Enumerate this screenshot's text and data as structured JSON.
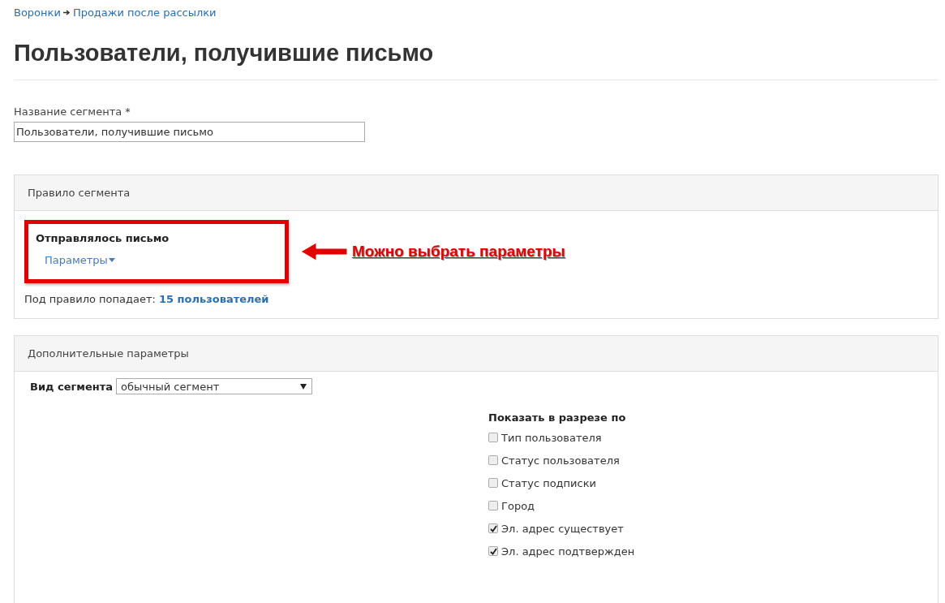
{
  "breadcrumb": [
    {
      "label": "Воронки"
    },
    {
      "label": "Продажи после рассылки"
    }
  ],
  "title": "Пользователи, получившие письмо",
  "segment_name": {
    "label": "Название сегмента",
    "required_mark": "*",
    "value": "Пользователи, получившие письмо"
  },
  "rule_panel": {
    "header": "Правило сегмента",
    "rule_title": "Отправлялось письмо",
    "params_link": "Параметры",
    "count_label": "Под правило попадает:",
    "count_link": "15 пользователей",
    "annotation": "Можно выбрать параметры"
  },
  "extra_panel": {
    "header": "Дополнительные параметры",
    "segment_type_label": "Вид сегмента",
    "segment_type_value": "обычный сегмент",
    "breakdown_title": "Показать в разрезе по",
    "breakdown": [
      {
        "label": "Тип пользователя",
        "checked": false
      },
      {
        "label": "Статус пользователя",
        "checked": false
      },
      {
        "label": "Статус подписки",
        "checked": false
      },
      {
        "label": "Город",
        "checked": false
      },
      {
        "label": "Эл. адрес существует",
        "checked": true
      },
      {
        "label": "Эл. адрес подтвержден",
        "checked": true
      }
    ]
  }
}
